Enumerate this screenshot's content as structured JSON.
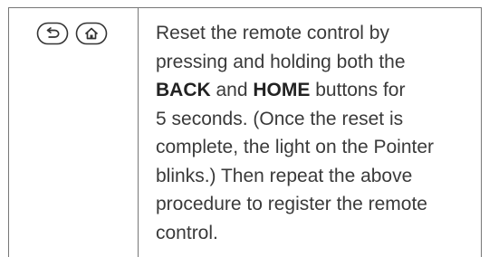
{
  "icons": {
    "back": "back-icon",
    "home": "home-icon"
  },
  "colors": {
    "rule": "#777777",
    "text": "#3a3a3a"
  },
  "instruction": {
    "line1": "Reset the remote control by",
    "line2": "pressing and holding both the",
    "back_label": "BACK",
    "and_word": " and ",
    "home_label": "HOME",
    "line3_tail": " buttons for",
    "line4": "5 seconds. (Once the reset is",
    "line5": "complete, the light on the Pointer",
    "line6": "blinks.) Then repeat the above",
    "line7": "procedure to register the remote",
    "line8": "control."
  }
}
